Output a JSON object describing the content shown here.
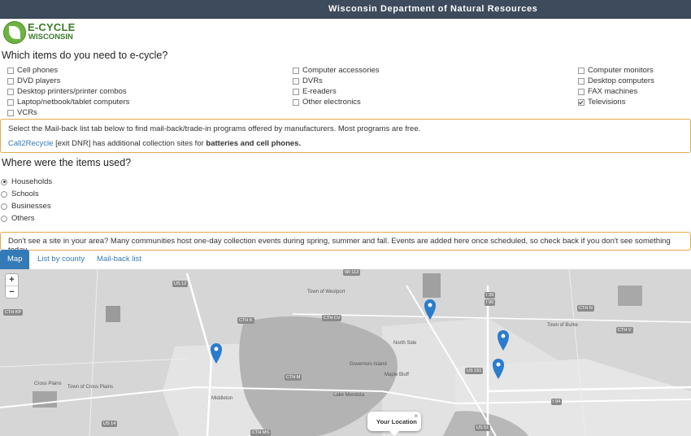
{
  "header": {
    "title": "Wisconsin Department of Natural Resources"
  },
  "logo": {
    "line1": "E-CYCLE",
    "line2": "WISCONSIN"
  },
  "items_section": {
    "question": "Which items do you need to e-cycle?",
    "items": [
      {
        "label": "Cell phones",
        "checked": false
      },
      {
        "label": "DVD players",
        "checked": false
      },
      {
        "label": "Desktop printers/printer combos",
        "checked": false
      },
      {
        "label": "Laptop/netbook/tablet computers",
        "checked": false
      },
      {
        "label": "VCRs",
        "checked": false
      },
      {
        "label": "Computer accessories",
        "checked": false
      },
      {
        "label": "DVRs",
        "checked": false
      },
      {
        "label": "E-readers",
        "checked": false
      },
      {
        "label": "Other electronics",
        "checked": false
      },
      {
        "label": "Computer monitors",
        "checked": false
      },
      {
        "label": "Desktop computers",
        "checked": false
      },
      {
        "label": "FAX machines",
        "checked": false
      },
      {
        "label": "Televisions",
        "checked": true
      }
    ]
  },
  "mailback_notice": {
    "line1": "Select the Mail-back list tab below to find mail-back/trade-in programs offered by manufacturers. Most programs are free.",
    "link": "Call2Recycle",
    "mid": " [exit DNR] has additional collection sites for ",
    "bold": "batteries and cell phones."
  },
  "location_section": {
    "question": "Where were the items used?",
    "options": [
      {
        "label": "Households",
        "selected": true
      },
      {
        "label": "Schools",
        "selected": false
      },
      {
        "label": "Businesses",
        "selected": false
      },
      {
        "label": "Others",
        "selected": false
      }
    ]
  },
  "events_notice": "Don't see a site in your area? Many communities host one-day collection events during spring, summer and fall. Events are added here once scheduled, so check back if you don't see something today.",
  "tabs": [
    {
      "label": "Map",
      "active": true
    },
    {
      "label": "List by county",
      "active": false
    },
    {
      "label": "Mail-back list",
      "active": false
    }
  ],
  "map": {
    "zoom_in": "+",
    "zoom_out": "−",
    "popup_text": "Your Location",
    "popup_close": "×",
    "labels": [
      "Town of Westport",
      "Town of Burke",
      "North Side",
      "Governors Island",
      "Maple Bluff",
      "Cross Plains",
      "Town of Cross Plains",
      "Middleton",
      "Lake Mendota"
    ],
    "shields": [
      "US 12",
      "CTH K",
      "CTH M",
      "US 151",
      "I 39",
      "I 90",
      "I 94",
      "US 51",
      "US 14",
      "CTH MS",
      "WI 113",
      "CTH KP",
      "CTH N",
      "CTH CV",
      "CTH V"
    ]
  }
}
